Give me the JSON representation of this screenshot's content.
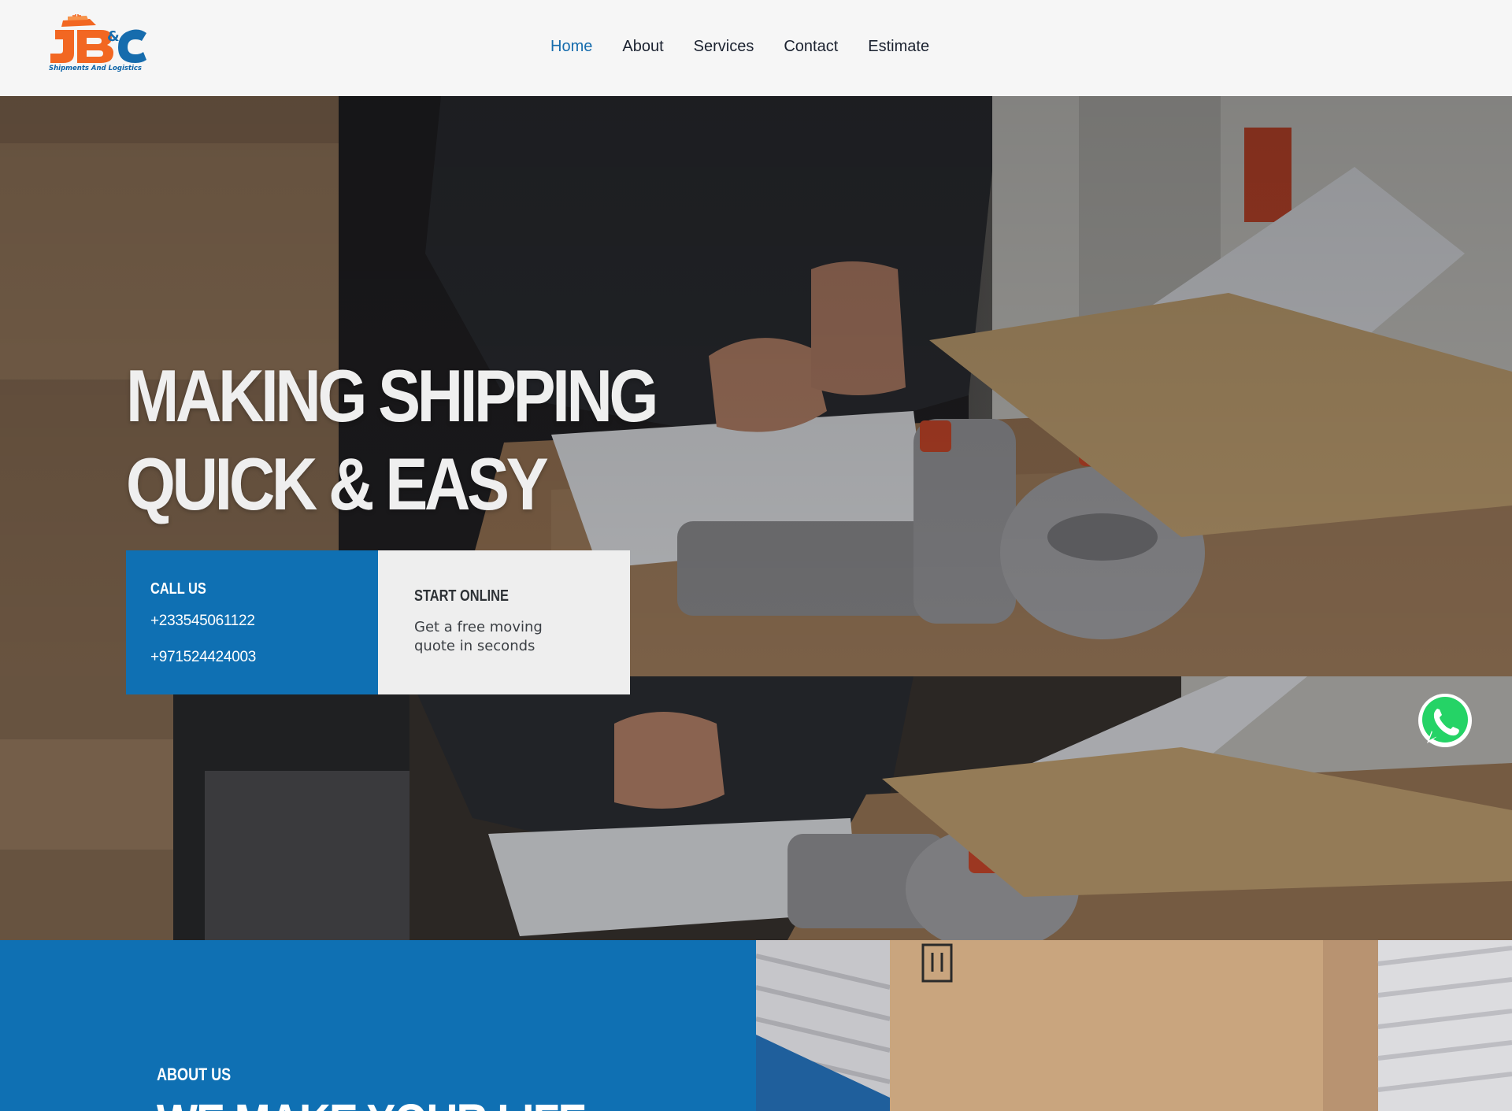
{
  "brand": {
    "logo_text": "JB&C",
    "tagline": "Shipments And Logistics",
    "colors": {
      "orange": "#f26722",
      "blue": "#166cad"
    }
  },
  "nav": {
    "items": [
      {
        "label": "Home",
        "active": true
      },
      {
        "label": "About",
        "active": false
      },
      {
        "label": "Services",
        "active": false
      },
      {
        "label": "Contact",
        "active": false
      },
      {
        "label": "Estimate",
        "active": false
      }
    ]
  },
  "hero": {
    "title": "MAKING SHIPPING\nQUICK & EASY",
    "call": {
      "title": "CALL US",
      "phones": [
        "+233545061122",
        "+971524424003"
      ]
    },
    "online": {
      "title": "START ONLINE",
      "text": "Get a free moving quote in seconds"
    }
  },
  "floating": {
    "icon": "whatsapp-icon"
  },
  "about": {
    "label": "ABOUT US",
    "heading": "WE MAKE YOUR LIFE"
  },
  "colors": {
    "primary_blue": "#0f70b3",
    "header_bg": "#f6f6f6",
    "light_panel": "#eeeeee",
    "whatsapp_green": "#25d366"
  }
}
